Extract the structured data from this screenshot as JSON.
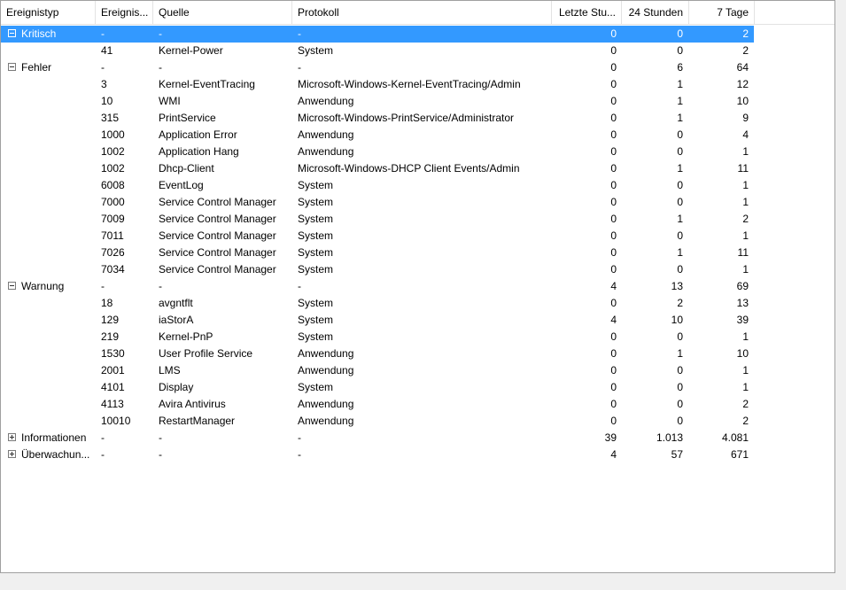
{
  "columns": {
    "type": "Ereignistyp",
    "id": "Ereignis...",
    "source": "Quelle",
    "log": "Protokoll",
    "last_hour": "Letzte Stu...",
    "day": "24 Stunden",
    "week": "7 Tage"
  },
  "rows": [
    {
      "kind": "group",
      "expanded": true,
      "selected": true,
      "type": "Kritisch",
      "id": "-",
      "source": "-",
      "log": "-",
      "h": "0",
      "d": "0",
      "w": "2"
    },
    {
      "kind": "item",
      "id": "41",
      "source": "Kernel-Power",
      "log": "System",
      "h": "0",
      "d": "0",
      "w": "2"
    },
    {
      "kind": "group",
      "expanded": true,
      "type": "Fehler",
      "id": "-",
      "source": "-",
      "log": "-",
      "h": "0",
      "d": "6",
      "w": "64"
    },
    {
      "kind": "item",
      "id": "3",
      "source": "Kernel-EventTracing",
      "log": "Microsoft-Windows-Kernel-EventTracing/Admin",
      "h": "0",
      "d": "1",
      "w": "12"
    },
    {
      "kind": "item",
      "id": "10",
      "source": "WMI",
      "log": "Anwendung",
      "h": "0",
      "d": "1",
      "w": "10"
    },
    {
      "kind": "item",
      "id": "315",
      "source": "PrintService",
      "log": "Microsoft-Windows-PrintService/Administrator",
      "h": "0",
      "d": "1",
      "w": "9"
    },
    {
      "kind": "item",
      "id": "1000",
      "source": "Application Error",
      "log": "Anwendung",
      "h": "0",
      "d": "0",
      "w": "4"
    },
    {
      "kind": "item",
      "id": "1002",
      "source": "Application Hang",
      "log": "Anwendung",
      "h": "0",
      "d": "0",
      "w": "1"
    },
    {
      "kind": "item",
      "id": "1002",
      "source": "Dhcp-Client",
      "log": "Microsoft-Windows-DHCP Client Events/Admin",
      "h": "0",
      "d": "1",
      "w": "11"
    },
    {
      "kind": "item",
      "id": "6008",
      "source": "EventLog",
      "log": "System",
      "h": "0",
      "d": "0",
      "w": "1"
    },
    {
      "kind": "item",
      "id": "7000",
      "source": "Service Control Manager",
      "log": "System",
      "h": "0",
      "d": "0",
      "w": "1"
    },
    {
      "kind": "item",
      "id": "7009",
      "source": "Service Control Manager",
      "log": "System",
      "h": "0",
      "d": "1",
      "w": "2"
    },
    {
      "kind": "item",
      "id": "7011",
      "source": "Service Control Manager",
      "log": "System",
      "h": "0",
      "d": "0",
      "w": "1"
    },
    {
      "kind": "item",
      "id": "7026",
      "source": "Service Control Manager",
      "log": "System",
      "h": "0",
      "d": "1",
      "w": "11"
    },
    {
      "kind": "item",
      "id": "7034",
      "source": "Service Control Manager",
      "log": "System",
      "h": "0",
      "d": "0",
      "w": "1"
    },
    {
      "kind": "group",
      "expanded": true,
      "type": "Warnung",
      "id": "-",
      "source": "-",
      "log": "-",
      "h": "4",
      "d": "13",
      "w": "69"
    },
    {
      "kind": "item",
      "id": "18",
      "source": "avgntflt",
      "log": "System",
      "h": "0",
      "d": "2",
      "w": "13"
    },
    {
      "kind": "item",
      "id": "129",
      "source": "iaStorA",
      "log": "System",
      "h": "4",
      "d": "10",
      "w": "39"
    },
    {
      "kind": "item",
      "id": "219",
      "source": "Kernel-PnP",
      "log": "System",
      "h": "0",
      "d": "0",
      "w": "1"
    },
    {
      "kind": "item",
      "id": "1530",
      "source": "User Profile Service",
      "log": "Anwendung",
      "h": "0",
      "d": "1",
      "w": "10"
    },
    {
      "kind": "item",
      "id": "2001",
      "source": "LMS",
      "log": "Anwendung",
      "h": "0",
      "d": "0",
      "w": "1"
    },
    {
      "kind": "item",
      "id": "4101",
      "source": "Display",
      "log": "System",
      "h": "0",
      "d": "0",
      "w": "1"
    },
    {
      "kind": "item",
      "id": "4113",
      "source": "Avira Antivirus",
      "log": "Anwendung",
      "h": "0",
      "d": "0",
      "w": "2"
    },
    {
      "kind": "item",
      "id": "10010",
      "source": "RestartManager",
      "log": "Anwendung",
      "h": "0",
      "d": "0",
      "w": "2"
    },
    {
      "kind": "group",
      "expanded": false,
      "type": "Informationen",
      "id": "-",
      "source": "-",
      "log": "-",
      "h": "39",
      "d": "1.013",
      "w": "4.081"
    },
    {
      "kind": "group",
      "expanded": false,
      "type": "Überwachun...",
      "id": "-",
      "source": "-",
      "log": "-",
      "h": "4",
      "d": "57",
      "w": "671"
    }
  ],
  "colors": {
    "selection": "#3399ff",
    "border": "#a0a0a0",
    "grid": "#e3e3e3"
  }
}
